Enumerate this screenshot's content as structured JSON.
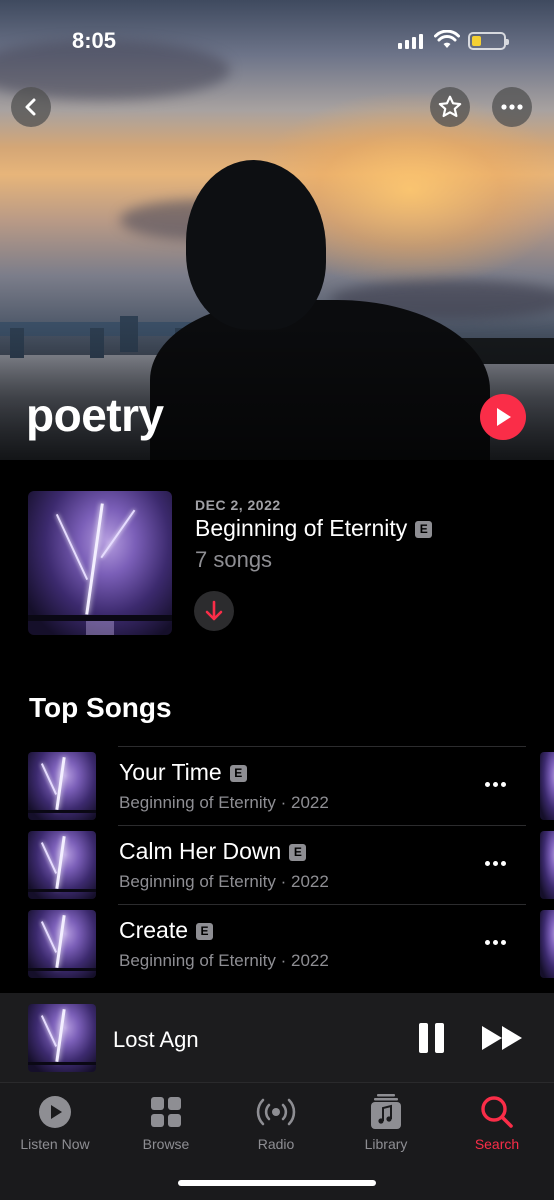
{
  "status_bar": {
    "time": "8:05",
    "battery_level": 0.3,
    "battery_color": "#f5d033"
  },
  "header": {
    "back_icon": "chevron-left-icon",
    "favorite_icon": "star-icon",
    "more_icon": "ellipsis-icon"
  },
  "artist": {
    "name": "poetry",
    "play_icon": "play-icon",
    "accent": "#fa2d48"
  },
  "latest_release": {
    "date": "DEC 2, 2022",
    "title": "Beginning of Eternity",
    "explicit": "E",
    "song_count": "7 songs",
    "download_icon": "arrow-down-icon"
  },
  "top_songs": {
    "title": "Top Songs",
    "songs": [
      {
        "title": "Your Time",
        "explicit": "E",
        "subtitle": "Beginning of Eternity · 2022"
      },
      {
        "title": "Calm Her Down",
        "explicit": "E",
        "subtitle": "Beginning of Eternity · 2022"
      },
      {
        "title": "Create",
        "explicit": "E",
        "subtitle": "Beginning of Eternity · 2022"
      }
    ]
  },
  "now_playing": {
    "title": "Lost Agn",
    "pause_icon": "pause-icon",
    "forward_icon": "forward-icon"
  },
  "tabs": [
    {
      "label": "Listen Now",
      "icon": "play-circle-icon",
      "active": false
    },
    {
      "label": "Browse",
      "icon": "grid-icon",
      "active": false
    },
    {
      "label": "Radio",
      "icon": "radio-waves-icon",
      "active": false
    },
    {
      "label": "Library",
      "icon": "library-icon",
      "active": false
    },
    {
      "label": "Search",
      "icon": "search-icon",
      "active": true
    }
  ]
}
